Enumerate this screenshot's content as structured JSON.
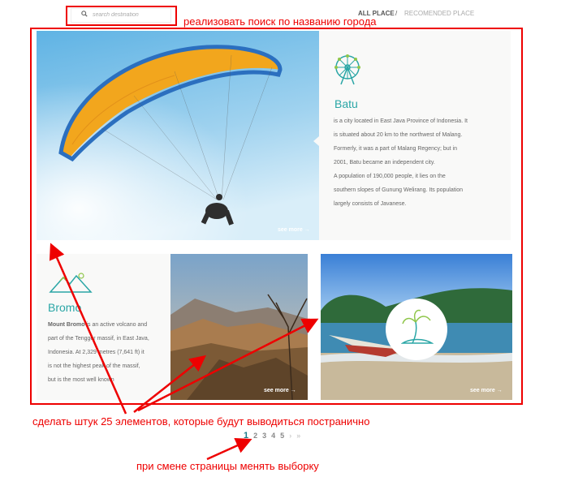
{
  "search": {
    "placeholder": "search destination"
  },
  "nav": {
    "all": "ALL PLACE",
    "separator": "/",
    "recommended": "RECOMENDED PLACE"
  },
  "annotations": {
    "search": "реализовать поиск по названию города",
    "items": "сделать штук 25 элементов, которые будут выводиться постранично",
    "paging": "при смене страницы менять выборку"
  },
  "batu": {
    "title": "Batu",
    "description": [
      " is a city located in East Java Province of Indonesia. It",
      "is situated about 20 km to the northwest of Malang.",
      "Formerly, it was a part of Malang Regency; but in",
      "2001, Batu became an independent city.",
      "A population of 190,000 people, it lies on the",
      "southern slopes of Gunung Welirang. Its population",
      "largely consists of Javanese."
    ],
    "see_more": "see more"
  },
  "bromo": {
    "title": "Bromo",
    "description_bold": "Mount Bromo",
    "description": [
      " is an active volcano and",
      "part of the Tengger massif, in East Java,",
      "Indonesia. At 2,329 metres (7,641 ft) it",
      "is not the highest peak of the massif,",
      "but is the most well known"
    ],
    "see_more": "see more"
  },
  "beach": {
    "see_more": "see more"
  },
  "pagination": {
    "pages": [
      "1",
      "2",
      "3",
      "4",
      "5"
    ],
    "active": "1",
    "next": "›",
    "last": "»"
  },
  "colors": {
    "accent": "#2aa6a6",
    "annotation": "#ee0000"
  }
}
